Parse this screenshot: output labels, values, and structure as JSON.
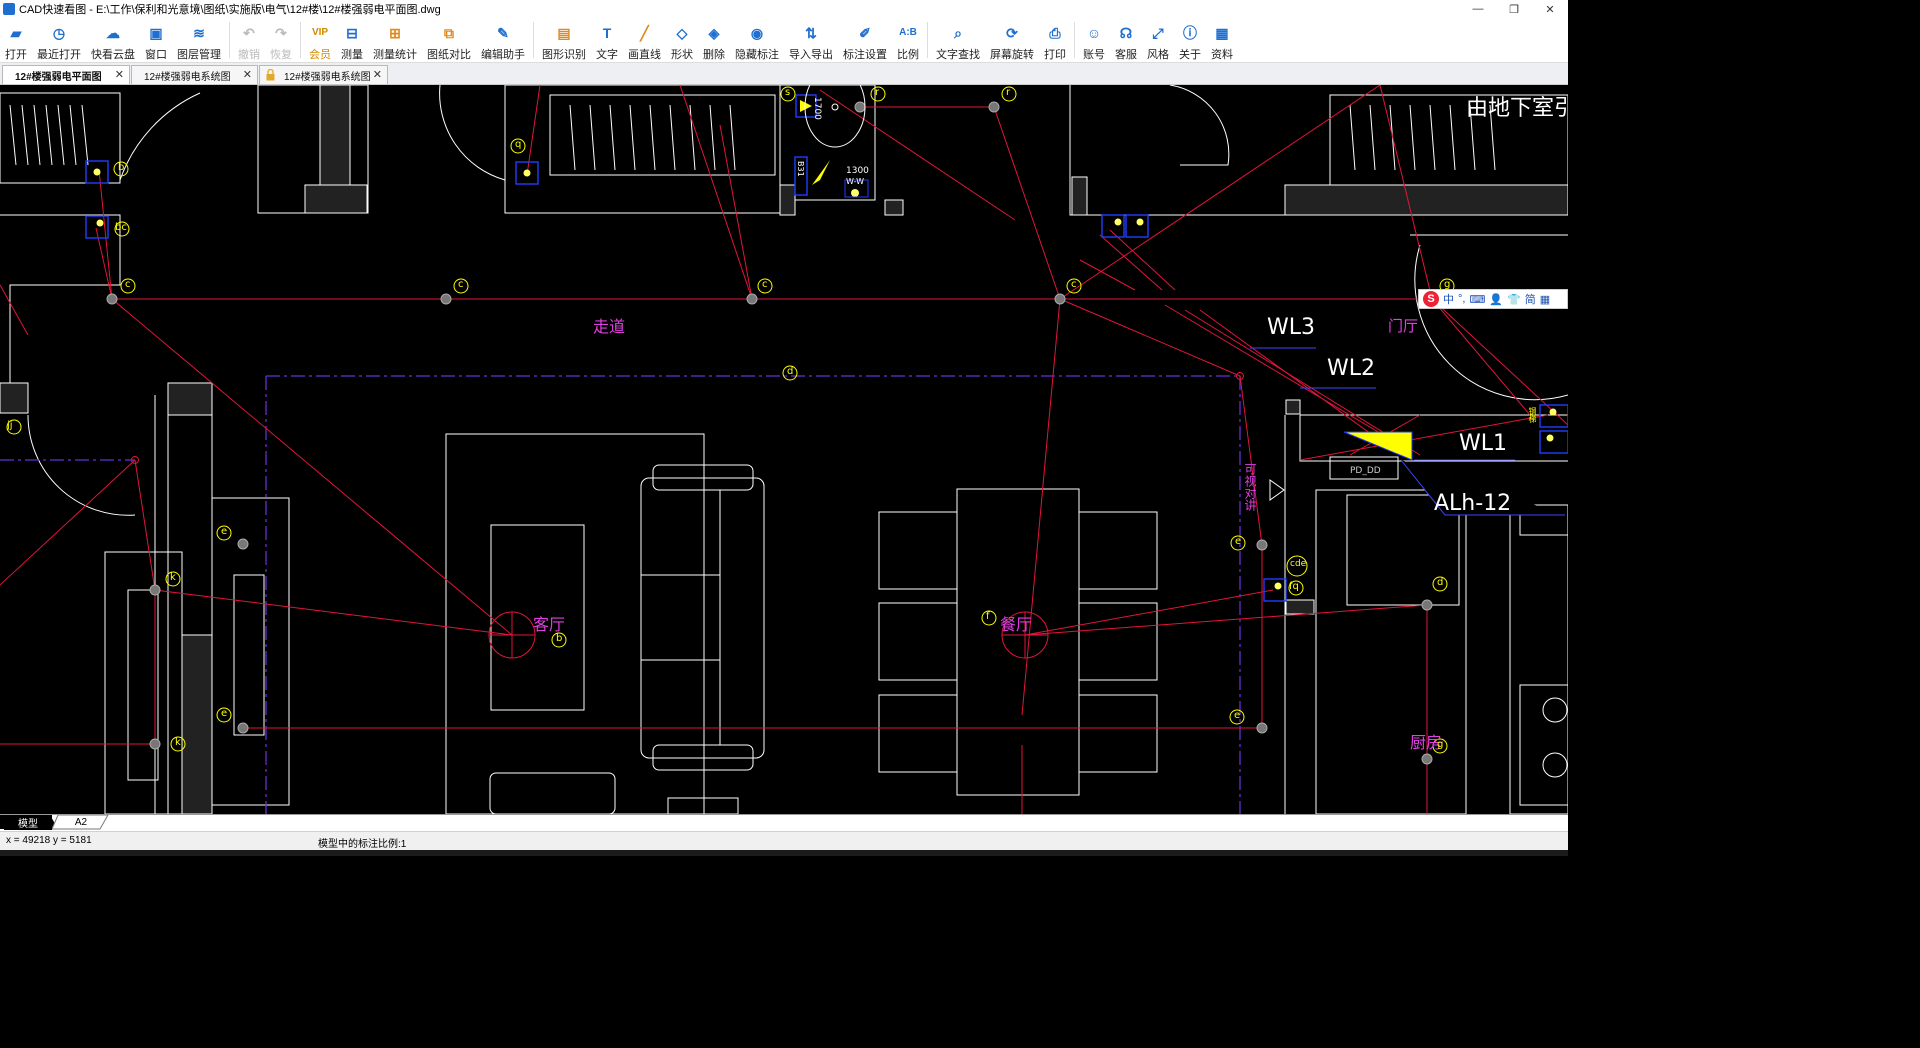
{
  "window": {
    "title": "CAD快速看图 - E:\\工作\\保利和光意境\\图纸\\实施版\\电气\\12#楼\\12#楼强弱电平面图.dwg",
    "controls": [
      "—",
      "❐",
      "✕"
    ]
  },
  "toolbar": {
    "items": [
      {
        "label": "打开",
        "icon": "folder-icon",
        "glyph": "▰",
        "color": "#1e6fd0"
      },
      {
        "label": "最近打开",
        "icon": "clock-icon",
        "glyph": "◷",
        "color": "#1e6fd0"
      },
      {
        "label": "快看云盘",
        "icon": "cloud-icon",
        "glyph": "☁",
        "color": "#1e6fd0"
      },
      {
        "label": "窗口",
        "icon": "window-icon",
        "glyph": "▣",
        "color": "#1e6fd0"
      },
      {
        "label": "图层管理",
        "icon": "layers-icon",
        "glyph": "≋",
        "color": "#1e6fd0"
      },
      {
        "label": "撤销",
        "icon": "undo-icon",
        "glyph": "↶",
        "color": "#bbb",
        "disabled": true
      },
      {
        "label": "恢复",
        "icon": "redo-icon",
        "glyph": "↷",
        "color": "#bbb",
        "disabled": true
      },
      {
        "label": "会员",
        "icon": "vip-icon",
        "glyph": "VIP",
        "color": "#d08a00",
        "vip": true
      },
      {
        "label": "测量",
        "icon": "ruler-icon",
        "glyph": "⊟",
        "color": "#1e6fd0"
      },
      {
        "label": "测量统计",
        "icon": "measure-stats-icon",
        "glyph": "⊞",
        "color": "#e08a1e"
      },
      {
        "label": "图纸对比",
        "icon": "compare-icon",
        "glyph": "⧉",
        "color": "#e08a1e"
      },
      {
        "label": "编辑助手",
        "icon": "edit-helper-icon",
        "glyph": "✎",
        "color": "#1e6fd0"
      },
      {
        "label": "图形识别",
        "icon": "shape-recognition-icon",
        "glyph": "▤",
        "color": "#e08a1e"
      },
      {
        "label": "文字",
        "icon": "text-icon",
        "glyph": "T",
        "color": "#1e6fd0"
      },
      {
        "label": "画直线",
        "icon": "line-icon",
        "glyph": "╱",
        "color": "#e08a1e"
      },
      {
        "label": "形状",
        "icon": "shape-icon",
        "glyph": "◇",
        "color": "#1e6fd0"
      },
      {
        "label": "删除",
        "icon": "eraser-icon",
        "glyph": "◈",
        "color": "#1e6fd0"
      },
      {
        "label": "隐藏标注",
        "icon": "hide-icon",
        "glyph": "◉",
        "color": "#1e6fd0"
      },
      {
        "label": "导入导出",
        "icon": "import-export-icon",
        "glyph": "⇅",
        "color": "#1e6fd0"
      },
      {
        "label": "标注设置",
        "icon": "annotation-settings-icon",
        "glyph": "✐",
        "color": "#1e6fd0"
      },
      {
        "label": "比例",
        "icon": "scale-icon",
        "glyph": "A:B",
        "color": "#1e6fd0"
      },
      {
        "label": "文字查找",
        "icon": "text-search-icon",
        "glyph": "⌕",
        "color": "#1e6fd0"
      },
      {
        "label": "屏幕旋转",
        "icon": "rotate-icon",
        "glyph": "⟳",
        "color": "#1e6fd0"
      },
      {
        "label": "打印",
        "icon": "print-icon",
        "glyph": "⎙",
        "color": "#1e6fd0"
      },
      {
        "label": "账号",
        "icon": "user-icon",
        "glyph": "☺",
        "color": "#1e6fd0"
      },
      {
        "label": "客服",
        "icon": "headset-icon",
        "glyph": "☊",
        "color": "#1e6fd0"
      },
      {
        "label": "风格",
        "icon": "style-icon",
        "glyph": "⤢",
        "color": "#1e6fd0"
      },
      {
        "label": "关于",
        "icon": "info-icon",
        "glyph": "ⓘ",
        "color": "#1e6fd0"
      },
      {
        "label": "资料",
        "icon": "docs-icon",
        "glyph": "▦",
        "color": "#1e6fd0"
      }
    ]
  },
  "tabs": [
    {
      "label": "12#楼强弱电平面图",
      "active": true,
      "close": "✕"
    },
    {
      "label": "12#楼强弱电系统图",
      "active": false,
      "close": "✕"
    },
    {
      "label": "12#楼强弱电系统图",
      "active": false,
      "close": "✕",
      "locked": true
    }
  ],
  "drawing": {
    "room_labels": [
      "走道",
      "门厅",
      "客厅",
      "餐厅",
      "厨房",
      "可视对讲"
    ],
    "circuit_labels": [
      "WL3",
      "WL2",
      "WL1",
      "ALh-12"
    ],
    "top_right_text": "由地下室引来",
    "markers": [
      "s",
      "r",
      "r",
      "b",
      "q",
      "bc",
      "c",
      "c",
      "c",
      "c",
      "g",
      "d",
      "jj",
      "e",
      "k",
      "e",
      "k",
      "b",
      "f",
      "e",
      "cde",
      "fq",
      "d",
      "e",
      "g"
    ],
    "fixture_text": [
      "1700",
      "1300",
      "W-W",
      "B31",
      "PD_DD",
      "钢梯"
    ],
    "colors": {
      "wall": "#ffffff",
      "wire": "#e0153a",
      "marker": "#ffff00",
      "label_magenta": "#e040e0",
      "axis": "#6a2cd8",
      "symbol_box": "#1f3cff"
    }
  },
  "ime": {
    "glyphs": [
      "S",
      "中",
      "°,",
      "⌨",
      "👤",
      "👕",
      "简",
      "▦"
    ]
  },
  "layout_tabs": [
    {
      "label": "模型",
      "active": true
    },
    {
      "label": "A2",
      "active": false
    }
  ],
  "status": {
    "coords": "x = 49218  y = 5181",
    "scale": "模型中的标注比例:1"
  }
}
